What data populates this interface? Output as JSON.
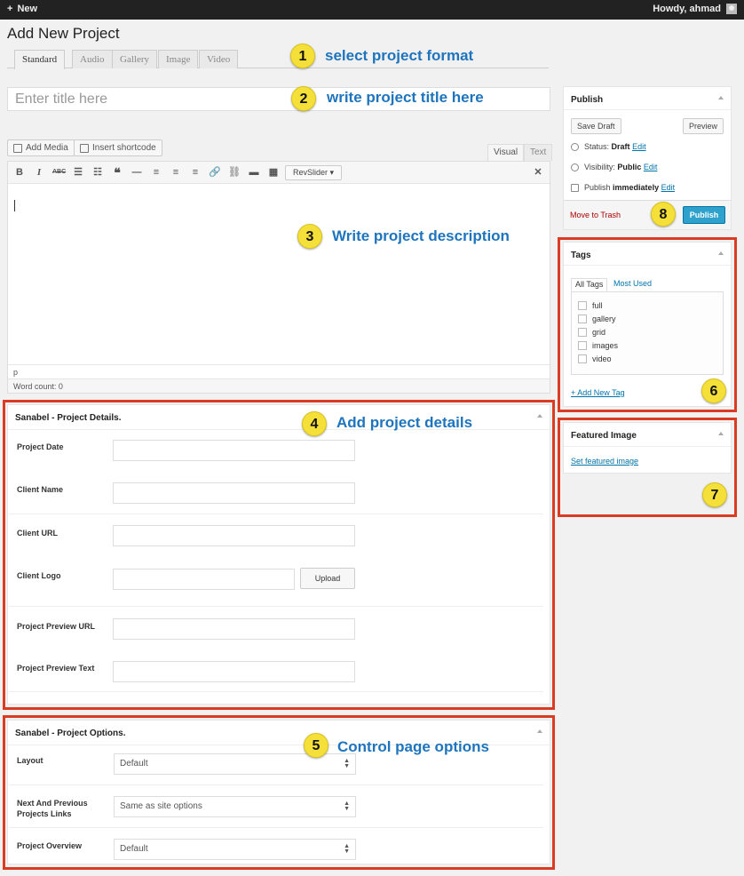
{
  "admin_bar": {
    "new_label": "New",
    "howdy": "Howdy, ahmad"
  },
  "page_title": "Add New Project",
  "format_tabs": [
    "Standard",
    "Audio",
    "Gallery",
    "Image",
    "Video"
  ],
  "title": {
    "placeholder": "Enter title here",
    "value": ""
  },
  "media_buttons": {
    "add_media": "Add Media",
    "insert_shortcode": "Insert shortcode"
  },
  "editor": {
    "visual_tab": "Visual",
    "text_tab": "Text",
    "toolbar_icons": [
      "bold-icon",
      "italic-icon",
      "strikethrough-icon",
      "bullet-list-icon",
      "numbered-list-icon",
      "blockquote-icon",
      "horizontal-rule-icon",
      "align-left-icon",
      "align-center-icon",
      "align-right-icon",
      "link-icon",
      "unlink-icon",
      "read-more-icon",
      "toolbar-toggle-icon",
      "fullscreen-icon"
    ],
    "revslider_label": "RevSlider",
    "path": "p",
    "word_count": "Word count: 0"
  },
  "annotations": [
    {
      "number": "1",
      "text": "select project format"
    },
    {
      "number": "2",
      "text": "write project title here"
    },
    {
      "number": "3",
      "text": "Write project description"
    },
    {
      "number": "4",
      "text": "Add project details"
    },
    {
      "number": "5",
      "text": "Control page options"
    },
    {
      "number": "6",
      "text": ""
    },
    {
      "number": "7",
      "text": ""
    },
    {
      "number": "8",
      "text": ""
    }
  ],
  "project_details": {
    "title": "Sanabel - Project Details.",
    "fields": [
      {
        "label": "Project Date",
        "value": ""
      },
      {
        "label": "Client Name",
        "value": ""
      },
      {
        "label": "Client URL",
        "value": ""
      },
      {
        "label": "Client Logo",
        "value": ""
      },
      {
        "label": "Project Preview URL",
        "value": ""
      },
      {
        "label": "Project Preview Text",
        "value": ""
      }
    ],
    "upload_label": "Upload"
  },
  "project_options": {
    "title": "Sanabel - Project Options.",
    "fields": [
      {
        "label": "Layout",
        "value": "Default"
      },
      {
        "label_line1": "Next And Previous",
        "label_line2": "Projects Links",
        "value": "Same as site options"
      },
      {
        "label": "Project Overview",
        "value": "Default"
      }
    ]
  },
  "publish": {
    "title": "Publish",
    "save_draft": "Save Draft",
    "preview": "Preview",
    "status_label": "Status:",
    "status_value": "Draft",
    "visibility_label": "Visibility:",
    "visibility_value": "Public",
    "publish_label": "Publish",
    "publish_value": "immediately",
    "edit": "Edit",
    "trash": "Move to Trash",
    "publish_button": "Publish"
  },
  "tags": {
    "title": "Tags",
    "tab_all": "All Tags",
    "tab_most_used": "Most Used",
    "items": [
      "full",
      "gallery",
      "grid",
      "images",
      "video"
    ],
    "add_new": "+ Add New Tag"
  },
  "featured_image": {
    "title": "Featured Image",
    "link": "Set featured image"
  },
  "colors": {
    "accent": "#1e74bd",
    "frame": "#d93c22",
    "badge": "#f5e03a",
    "publish": "#2ea2cc"
  }
}
